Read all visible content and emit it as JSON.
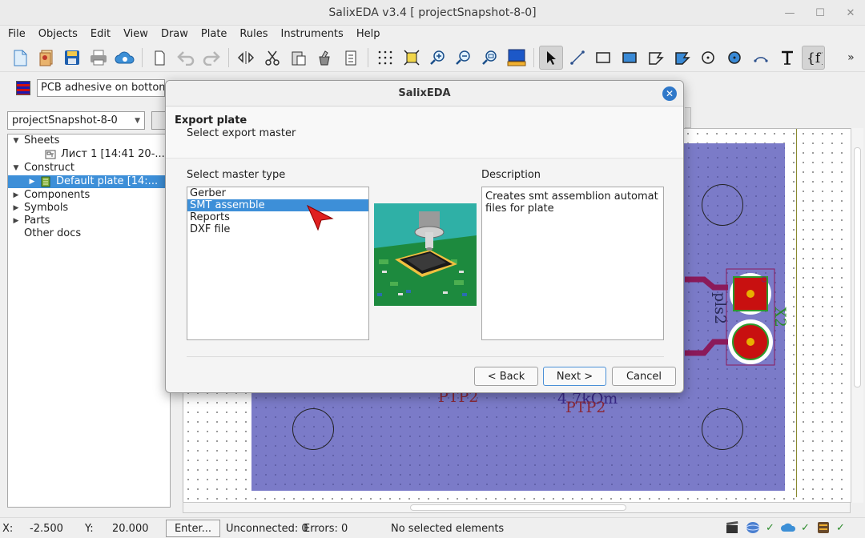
{
  "window": {
    "title": "SalixEDA v3.4 [ projectSnapshot-8-0]",
    "controls": {
      "minimize": "—",
      "maximize": "☐",
      "close": "✕"
    }
  },
  "menu": [
    "File",
    "Objects",
    "Edit",
    "View",
    "Draw",
    "Plate",
    "Rules",
    "Instruments",
    "Help"
  ],
  "toolbar": {
    "icons": [
      "new-file-icon",
      "new-project-icon",
      "save-icon",
      "print-icon",
      "cloud-icon",
      "copy-page-icon",
      "undo-icon",
      "redo-icon",
      "mirror-icon",
      "cut-icon",
      "paste-icon",
      "clean-icon",
      "properties-icon",
      "grid-icon",
      "fit-icon",
      "zoom-in-icon",
      "zoom-out-icon",
      "zoom-window-icon",
      "monitor-icon",
      "pointer-icon",
      "line-icon",
      "rectangle-icon",
      "filled-rect-icon",
      "polygon-icon",
      "filled-polygon-icon",
      "circle-icon",
      "filled-circle-icon",
      "arc-icon",
      "text-icon",
      "field-icon",
      "more-icon"
    ],
    "more": "»"
  },
  "layer": {
    "selected": "PCB adhesive on bottom"
  },
  "project": {
    "selected": "projectSnapshot-8-0"
  },
  "tree": {
    "sheets": "Sheets",
    "sheet1": "Лист 1 [14:41 20-...",
    "construct": "Construct",
    "default_plate": "Default plate [14:...",
    "components": "Components",
    "symbols": "Symbols",
    "parts": "Parts",
    "other_docs": "Other docs"
  },
  "canvas": {
    "labels": {
      "pls2": "pls2",
      "x2": "X2",
      "ptp2_a": "PTP2",
      "ptp2_b": "PTP2",
      "resistor": "4.7kOm"
    },
    "colors": {
      "plate": "#7b7bc8",
      "pad": "#c81010",
      "trace": "#8b1a5a"
    }
  },
  "status": {
    "x_label": "X:",
    "x_value": "-2.500",
    "y_label": "Y:",
    "y_value": "20.000",
    "enter": "Enter...",
    "unconnected": "Unconnected: 0",
    "errors": "Errors: 0",
    "selection": "No selected elements",
    "check": "✓"
  },
  "dialog": {
    "title": "SalixEDA",
    "close": "✕",
    "heading": "Export plate",
    "subheading": "Select export master",
    "master_type_label": "Select master type",
    "description_label": "Description",
    "master_types": [
      "Gerber",
      "SMT assemble",
      "Reports",
      "DXF file"
    ],
    "selected_index": 1,
    "description": "Creates smt assemblion automat files for plate",
    "buttons": {
      "back": "< Back",
      "next": "Next >",
      "cancel": "Cancel"
    }
  }
}
